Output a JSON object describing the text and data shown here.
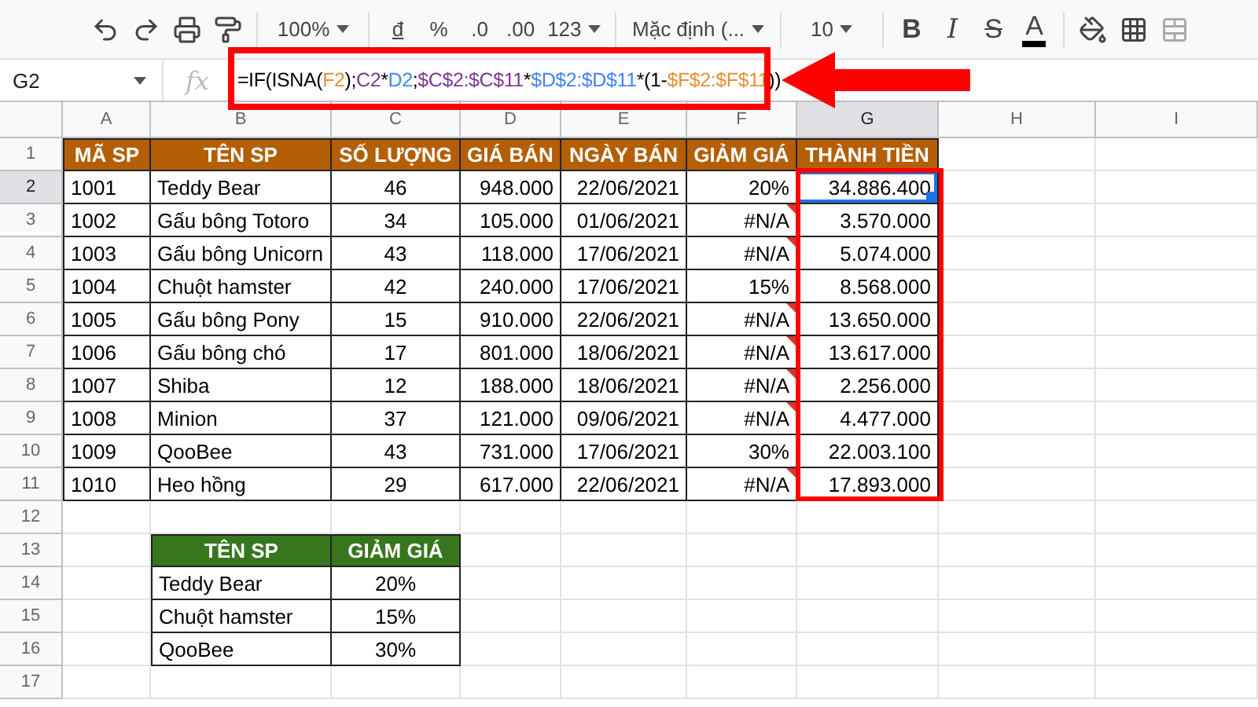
{
  "toolbar": {
    "zoom": "100%",
    "currency": "đ",
    "percent": "%",
    "decrease_decimals": ".0",
    "increase_decimals": ".00",
    "number_format": "123",
    "font": "Mặc định (...",
    "font_size": "10",
    "bold": "B",
    "italic": "I",
    "strikethrough": "S",
    "text_color": "A"
  },
  "formula_bar": {
    "cell": "G2",
    "fx": "fx",
    "formula": [
      {
        "text": "=IF(ISNA(",
        "color": "#000000"
      },
      {
        "text": "F2",
        "color": "#e69138"
      },
      {
        "text": ");",
        "color": "#000000"
      },
      {
        "text": "C2",
        "color": "#7e3794"
      },
      {
        "text": "*",
        "color": "#000000"
      },
      {
        "text": "D2",
        "color": "#4285f4"
      },
      {
        "text": ";",
        "color": "#000000"
      },
      {
        "text": "$C$2:$C$11",
        "color": "#7e3794"
      },
      {
        "text": "*",
        "color": "#000000"
      },
      {
        "text": "$D$2:$D$11",
        "color": "#4285f4"
      },
      {
        "text": "*(1-",
        "color": "#000000"
      },
      {
        "text": "$F$2:$F$11",
        "color": "#e69138"
      },
      {
        "text": "))",
        "color": "#000000"
      }
    ]
  },
  "columns": [
    {
      "label": "A",
      "selected": false
    },
    {
      "label": "B",
      "selected": false
    },
    {
      "label": "C",
      "selected": false
    },
    {
      "label": "D",
      "selected": false
    },
    {
      "label": "E",
      "selected": false
    },
    {
      "label": "F",
      "selected": false
    },
    {
      "label": "G",
      "selected": true
    },
    {
      "label": "H",
      "selected": false
    },
    {
      "label": "I",
      "selected": false
    }
  ],
  "row_numbers": [
    {
      "label": "1",
      "selected": false
    },
    {
      "label": "2",
      "selected": true
    },
    {
      "label": "3",
      "selected": false
    },
    {
      "label": "4",
      "selected": false
    },
    {
      "label": "5",
      "selected": false
    },
    {
      "label": "6",
      "selected": false
    },
    {
      "label": "7",
      "selected": false
    },
    {
      "label": "8",
      "selected": false
    },
    {
      "label": "9",
      "selected": false
    },
    {
      "label": "10",
      "selected": false
    },
    {
      "label": "11",
      "selected": false
    },
    {
      "label": "12",
      "selected": false
    },
    {
      "label": "13",
      "selected": false
    },
    {
      "label": "14",
      "selected": false
    },
    {
      "label": "15",
      "selected": false
    },
    {
      "label": "16",
      "selected": false
    },
    {
      "label": "17",
      "selected": false
    }
  ],
  "main_table": {
    "header": [
      "MÃ SP",
      "TÊN SP",
      "SỐ LƯỢNG",
      "GIÁ BÁN",
      "NGÀY BÁN",
      "GIẢM GIÁ",
      "THÀNH TIỀN"
    ],
    "rows": [
      {
        "code": "1001",
        "name": "Teddy Bear",
        "quantity": "46",
        "price": "948.000",
        "date": "22/06/2021",
        "discount": "20%",
        "error": false,
        "total": "34.886.400"
      },
      {
        "code": "1002",
        "name": "Gấu bông Totoro",
        "quantity": "34",
        "price": "105.000",
        "date": "01/06/2021",
        "discount": "#N/A",
        "error": true,
        "total": "3.570.000"
      },
      {
        "code": "1003",
        "name": "Gấu bông Unicorn",
        "quantity": "43",
        "price": "118.000",
        "date": "17/06/2021",
        "discount": "#N/A",
        "error": true,
        "total": "5.074.000"
      },
      {
        "code": "1004",
        "name": "Chuột hamster",
        "quantity": "42",
        "price": "240.000",
        "date": "17/06/2021",
        "discount": "15%",
        "error": false,
        "total": "8.568.000"
      },
      {
        "code": "1005",
        "name": "Gấu bông Pony",
        "quantity": "15",
        "price": "910.000",
        "date": "22/06/2021",
        "discount": "#N/A",
        "error": true,
        "total": "13.650.000"
      },
      {
        "code": "1006",
        "name": "Gấu bông chó",
        "quantity": "17",
        "price": "801.000",
        "date": "18/06/2021",
        "discount": "#N/A",
        "error": true,
        "total": "13.617.000"
      },
      {
        "code": "1007",
        "name": "Shiba",
        "quantity": "12",
        "price": "188.000",
        "date": "18/06/2021",
        "discount": "#N/A",
        "error": true,
        "total": "2.256.000"
      },
      {
        "code": "1008",
        "name": "Minion",
        "quantity": "37",
        "price": "121.000",
        "date": "09/06/2021",
        "discount": "#N/A",
        "error": true,
        "total": "4.477.000"
      },
      {
        "code": "1009",
        "name": "QooBee",
        "quantity": "43",
        "price": "731.000",
        "date": "17/06/2021",
        "discount": "30%",
        "error": false,
        "total": "22.003.100"
      },
      {
        "code": "1010",
        "name": "Heo hồng",
        "quantity": "29",
        "price": "617.000",
        "date": "22/06/2021",
        "discount": "#N/A",
        "error": true,
        "total": "17.893.000"
      }
    ]
  },
  "lookup_table": {
    "header": [
      "TÊN SP",
      "GIẢM GIÁ"
    ],
    "rows": [
      {
        "name": "Teddy Bear",
        "discount": "20%"
      },
      {
        "name": "Chuột hamster",
        "discount": "15%"
      },
      {
        "name": "QooBee",
        "discount": "30%"
      }
    ]
  }
}
